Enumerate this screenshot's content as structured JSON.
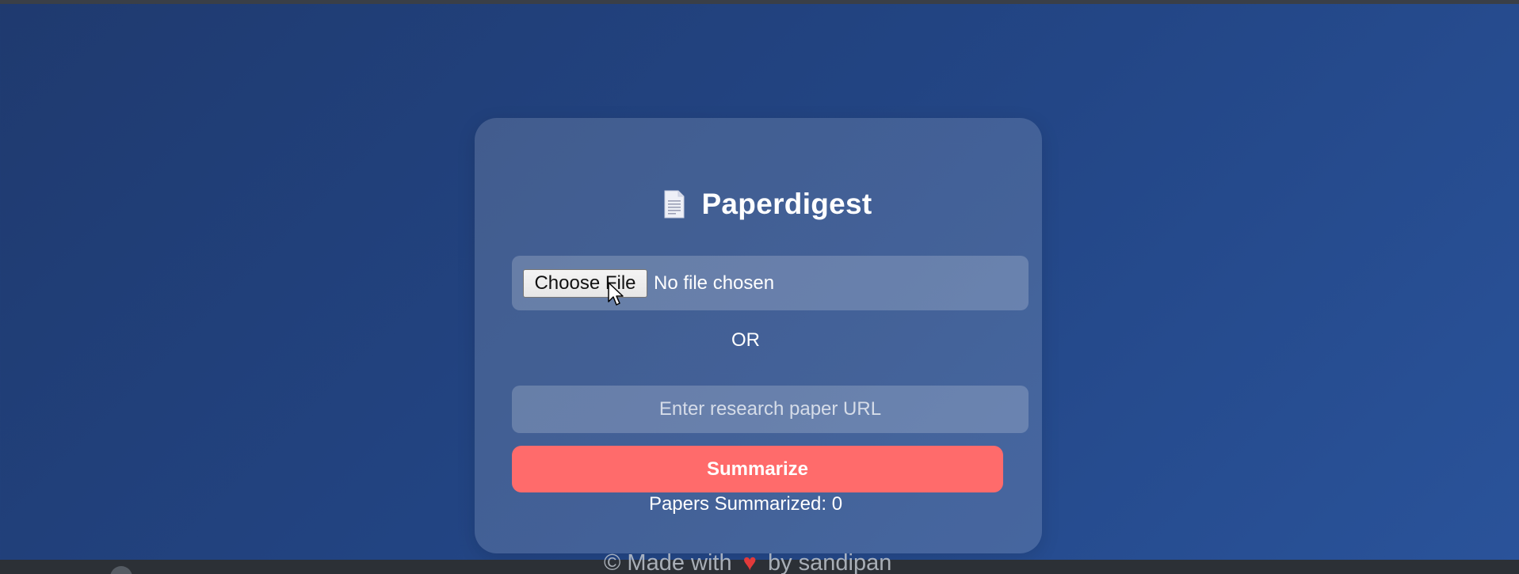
{
  "app": {
    "title": "Paperdigest",
    "title_icon": "document-icon"
  },
  "upload": {
    "button_label": "Choose File",
    "status": "No file chosen"
  },
  "divider_text": "OR",
  "url_input": {
    "placeholder": "Enter research paper URL",
    "value": ""
  },
  "summarize_button": {
    "label": "Summarize",
    "color": "#ff6b6b"
  },
  "counter": {
    "text": "Papers Summarized: 0"
  },
  "footer": {
    "prefix": "© Made with",
    "heart_icon": "heart-icon",
    "heart": "♥",
    "suffix": "by sandipan"
  },
  "colors": {
    "background": "#234686",
    "card": "rgba(255,255,255,0.15)",
    "accent": "#ff6b6b"
  }
}
